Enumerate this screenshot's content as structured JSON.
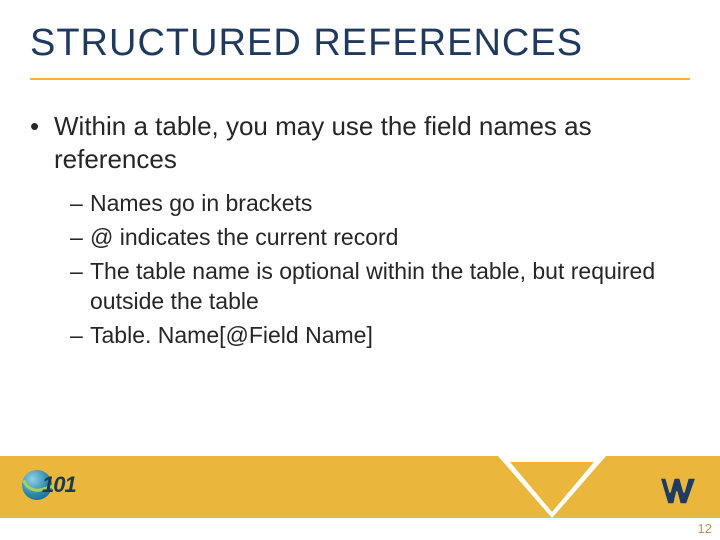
{
  "title": "STRUCTURED REFERENCES",
  "bullet1": "Within a table, you may use the field names as references",
  "sub1": "Names go in brackets",
  "sub2": "@ indicates the current record",
  "sub3": "The table name is optional within the table, but required outside the table",
  "sub4": "Table. Name[@Field Name]",
  "logo101_text": "101",
  "page_number": "12",
  "bullet_glyph": "•",
  "dash_glyph": "–"
}
